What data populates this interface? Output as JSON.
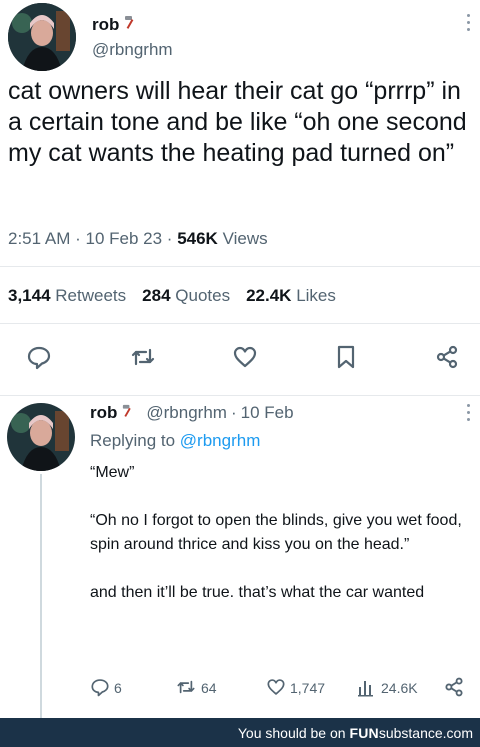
{
  "tweet": {
    "display_name": "rob",
    "name_emoji": "hammer-emoji",
    "handle": "@rbngrhm",
    "text": "cat owners will hear their cat go “prrrp” in a certain tone and be like “oh one second my cat wants the heating pad turned on”",
    "time": "2:51 AM",
    "date": "10 Feb 23",
    "views_count": "546K",
    "views_label": "Views",
    "retweets_count": "3,144",
    "retweets_label": "Retweets",
    "quotes_count": "284",
    "quotes_label": "Quotes",
    "likes_count": "22.4K",
    "likes_label": "Likes",
    "actions": [
      "reply-icon",
      "retweet-icon",
      "like-icon",
      "bookmark-icon",
      "share-icon"
    ]
  },
  "reply": {
    "display_name": "rob",
    "handle": "@rbngrhm",
    "date": "10 Feb",
    "replying_prefix": "Replying to",
    "replying_to": "@rbngrhm",
    "paragraphs": [
      "“Mew”",
      "“Oh no I forgot to open the blinds, give you wet food, spin around thrice and kiss you on the head.”",
      "and then it’ll be true. that’s what the car wanted"
    ],
    "replies": "6",
    "retweets": "64",
    "likes": "1,747",
    "views": "24.6K"
  },
  "footer": {
    "prefix": "You should be on",
    "brand_a": "FUN",
    "brand_b": "substance",
    "brand_c": ".com"
  },
  "colors": {
    "text": "#0f1419",
    "secondary": "#536471",
    "link": "#1d9bf0",
    "footer_bg": "#1b3248"
  }
}
